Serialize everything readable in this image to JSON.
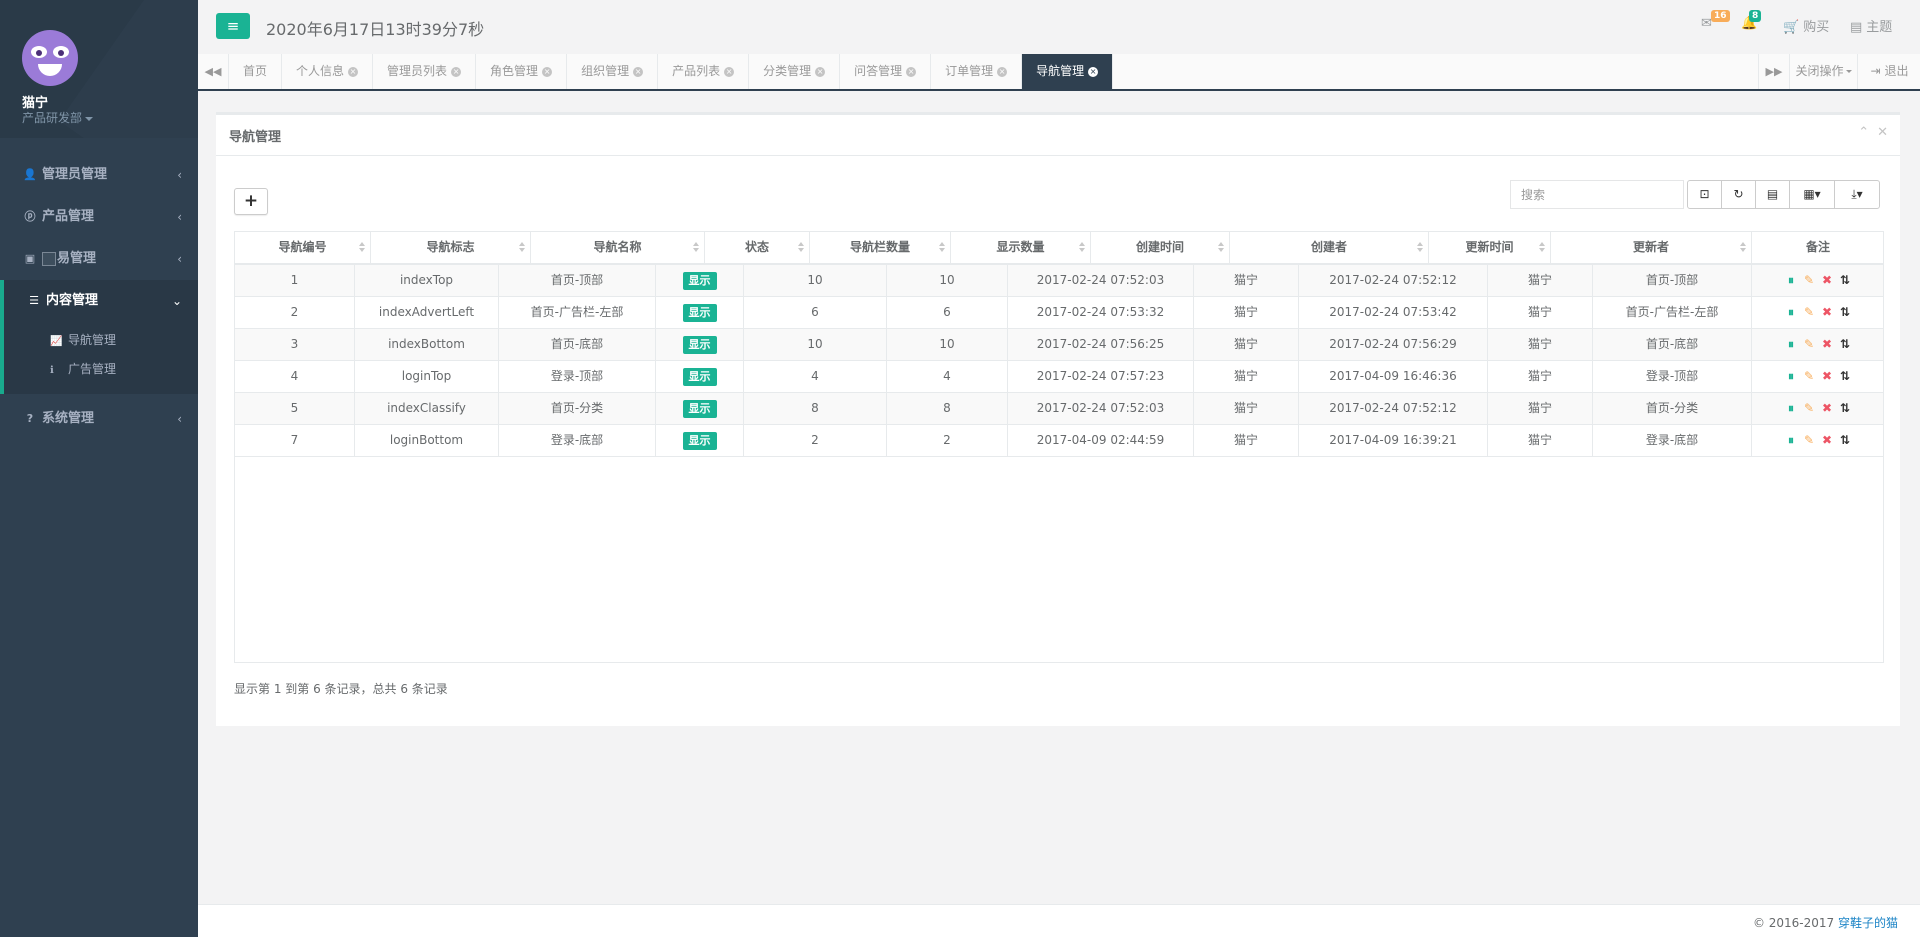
{
  "user": {
    "name": "猫宁",
    "dept": "产品研发部"
  },
  "sidebar": {
    "items": [
      {
        "label": "管理员管理"
      },
      {
        "label": "产品管理"
      },
      {
        "label": "易管理"
      },
      {
        "label": "内容管理"
      },
      {
        "label": "系统管理"
      }
    ],
    "subitems": [
      {
        "label": "导航管理"
      },
      {
        "label": "广告管理"
      }
    ]
  },
  "topbar": {
    "clock": "2020年6月17日13时39分7秒",
    "mail_count": "16",
    "bell_count": "8",
    "buy_label": "购买",
    "theme_label": "主题"
  },
  "tabs": [
    "首页",
    "个人信息",
    "管理员列表",
    "角色管理",
    "组织管理",
    "产品列表",
    "分类管理",
    "问答管理",
    "订单管理",
    "导航管理"
  ],
  "tabbar": {
    "close_ops": "关闭操作",
    "logout": "退出"
  },
  "panel": {
    "title": "导航管理"
  },
  "search": {
    "placeholder": "搜索"
  },
  "table": {
    "headers": [
      "导航编号",
      "导航标志",
      "导航名称",
      "状态",
      "导航栏数量",
      "显示数量",
      "创建时间",
      "创建者",
      "更新时间",
      "更新者",
      "备注"
    ],
    "rows": [
      [
        "1",
        "indexTop",
        "首页-顶部",
        "显示",
        "10",
        "10",
        "2017-02-24 07:52:03",
        "猫宁",
        "2017-02-24 07:52:12",
        "猫宁",
        "首页-顶部"
      ],
      [
        "2",
        "indexAdvertLeft",
        "首页-广告栏-左部",
        "显示",
        "6",
        "6",
        "2017-02-24 07:53:32",
        "猫宁",
        "2017-02-24 07:53:42",
        "猫宁",
        "首页-广告栏-左部"
      ],
      [
        "3",
        "indexBottom",
        "首页-底部",
        "显示",
        "10",
        "10",
        "2017-02-24 07:56:25",
        "猫宁",
        "2017-02-24 07:56:29",
        "猫宁",
        "首页-底部"
      ],
      [
        "4",
        "loginTop",
        "登录-顶部",
        "显示",
        "4",
        "4",
        "2017-02-24 07:57:23",
        "猫宁",
        "2017-04-09 16:46:36",
        "猫宁",
        "登录-顶部"
      ],
      [
        "5",
        "indexClassify",
        "首页-分类",
        "显示",
        "8",
        "8",
        "2017-02-24 07:52:03",
        "猫宁",
        "2017-02-24 07:52:12",
        "猫宁",
        "首页-分类"
      ],
      [
        "7",
        "loginBottom",
        "登录-底部",
        "显示",
        "2",
        "2",
        "2017-04-09 02:44:59",
        "猫宁",
        "2017-04-09 16:39:21",
        "猫宁",
        "登录-底部"
      ]
    ]
  },
  "pagination": {
    "info": "显示第 1 到第 6 条记录，总共 6 条记录"
  },
  "footer": {
    "copyright": "© 2016-2017 ",
    "author": "穿鞋子的猫"
  },
  "colors": {
    "sidebar": "#2f4050",
    "accent": "#1ab394",
    "warning": "#f8ac59",
    "danger": "#ed5565",
    "link": "#1c84c6"
  }
}
